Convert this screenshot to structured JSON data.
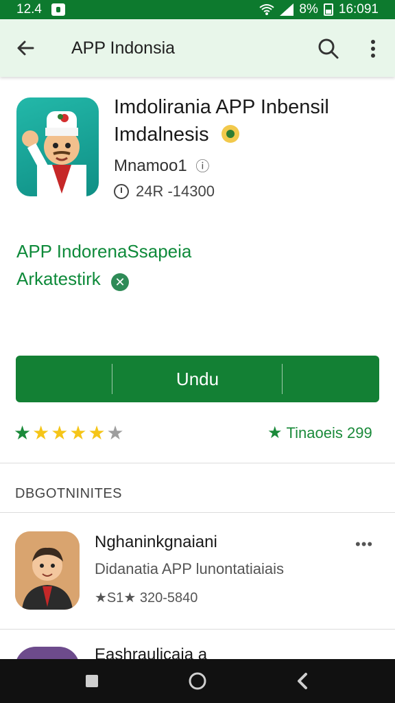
{
  "status_bar": {
    "time": "12.4",
    "battery": "8%",
    "clock": "16:091"
  },
  "app_bar": {
    "title": "APP Indonsia"
  },
  "app": {
    "name_line1": "Imdolirania APP Inbensil",
    "name_line2": "Imdalnesis",
    "developer": "Mnamoo1",
    "info_glyph": "ⓘ",
    "size": "24R -14300"
  },
  "tagline": {
    "line1": "APP IndorenaSsapeia",
    "line2": "Arkatestirk",
    "badge": "✕"
  },
  "install": {
    "label": "Undu"
  },
  "rating": {
    "stars_green": 1,
    "stars_yellow": 4,
    "stars_grey": 1,
    "right_text": "Tinaoeis 299"
  },
  "reviews": {
    "section_title": "DBGOTNINITES",
    "items": [
      {
        "name": "Nghaninkgnaiani",
        "text": "Didanatia APP lunontatiaiais",
        "meta": "★S1★ 320-5840",
        "more": "•••"
      }
    ],
    "next_name": "Eashraulicaia a"
  },
  "colors": {
    "accent": "#138034",
    "status_bar": "#0d7a2e",
    "app_bar": "#e8f6ea"
  },
  "icons": [
    "back-icon",
    "search-icon",
    "more-vert-icon",
    "wifi-icon",
    "signal-icon",
    "battery-icon",
    "clock-icon",
    "verified-icon",
    "star-icon",
    "home-icon",
    "recents-icon",
    "nav-back-icon"
  ]
}
